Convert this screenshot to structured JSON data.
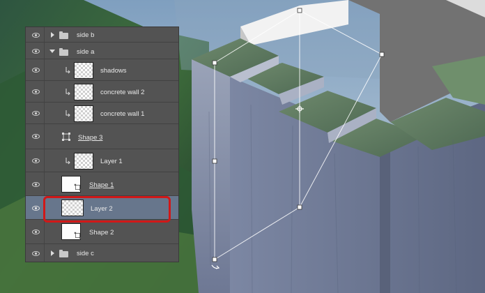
{
  "layers_panel": {
    "rows": [
      {
        "name": "side b",
        "kind": "group",
        "expanded": false
      },
      {
        "name": "side a",
        "kind": "group",
        "expanded": true
      },
      {
        "name": "shadows",
        "kind": "layer",
        "clipped": true
      },
      {
        "name": "concrete wall 2",
        "kind": "layer",
        "clipped": true
      },
      {
        "name": "concrete wall 1",
        "kind": "layer",
        "clipped": true
      },
      {
        "name": "Shape 3",
        "kind": "shape"
      },
      {
        "name": "Layer 1",
        "kind": "layer",
        "clipped": true
      },
      {
        "name": "Shape 1",
        "kind": "shape"
      },
      {
        "name": "Layer 2",
        "kind": "layer",
        "selected": true
      },
      {
        "name": "Shape 2",
        "kind": "shape"
      },
      {
        "name": "side c",
        "kind": "group",
        "expanded": false
      }
    ],
    "selected_layer": "Layer 2",
    "highlight_color": "#d01818",
    "selection_color": "#67768c"
  },
  "icons": {
    "visibility": "eye-icon",
    "group": "folder-icon",
    "clip": "clipping-arrow-icon",
    "shape": "vector-shape-icon"
  },
  "canvas": {
    "subject": "isometric concrete block with mossy stair edge over mountain background"
  }
}
